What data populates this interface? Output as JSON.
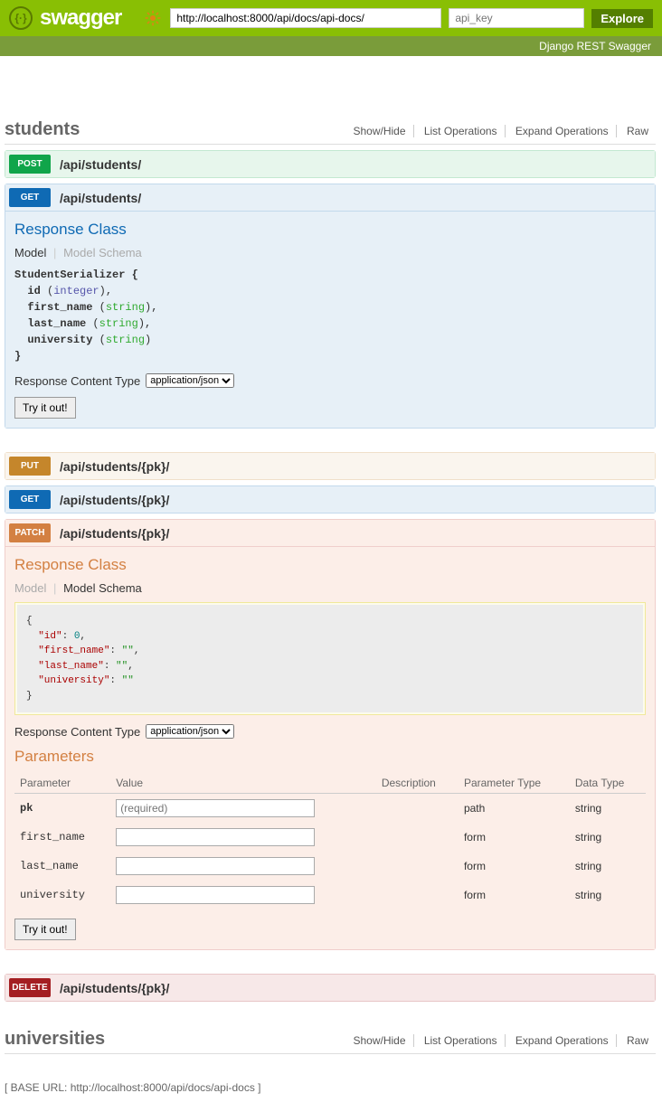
{
  "header": {
    "logo": "swagger",
    "url": "http://localhost:8000/api/docs/api-docs/",
    "apikey_placeholder": "api_key",
    "explore": "Explore",
    "subtitle": "Django REST Swagger"
  },
  "resources": {
    "students": {
      "title": "students",
      "actions": {
        "showhide": "Show/Hide",
        "list": "List Operations",
        "expand": "Expand Operations",
        "raw": "Raw"
      }
    },
    "universities": {
      "title": "universities",
      "actions": {
        "showhide": "Show/Hide",
        "list": "List Operations",
        "expand": "Expand Operations",
        "raw": "Raw"
      }
    }
  },
  "ops": {
    "post": {
      "method": "POST",
      "path": "/api/students/"
    },
    "get": {
      "method": "GET",
      "path": "/api/students/"
    },
    "put": {
      "method": "PUT",
      "path": "/api/students/{pk}/"
    },
    "get2": {
      "method": "GET",
      "path": "/api/students/{pk}/"
    },
    "patch": {
      "method": "PATCH",
      "path": "/api/students/{pk}/"
    },
    "del": {
      "method": "DELETE",
      "path": "/api/students/{pk}/"
    }
  },
  "labels": {
    "response_class": "Response Class",
    "model": "Model",
    "model_schema": "Model Schema",
    "resp_content_type": "Response Content Type",
    "content_type": "application/json",
    "try": "Try it out!",
    "parameters": "Parameters",
    "th_parameter": "Parameter",
    "th_value": "Value",
    "th_description": "Description",
    "th_param_type": "Parameter Type",
    "th_data_type": "Data Type"
  },
  "get_model": {
    "name": "StudentSerializer",
    "f1": "id",
    "t1": "integer",
    "f2": "first_name",
    "t2": "string",
    "f3": "last_name",
    "t3": "string",
    "f4": "university",
    "t4": "string"
  },
  "patch_schema": {
    "k1": "\"id\"",
    "v1": "0",
    "k2": "\"first_name\"",
    "v2": "\"\"",
    "k3": "\"last_name\"",
    "v3": "\"\"",
    "k4": "\"university\"",
    "v4": "\"\""
  },
  "patch_params": {
    "r1": {
      "name": "pk",
      "placeholder": "(required)",
      "ptype": "path",
      "dtype": "string"
    },
    "r2": {
      "name": "first_name",
      "ptype": "form",
      "dtype": "string"
    },
    "r3": {
      "name": "last_name",
      "ptype": "form",
      "dtype": "string"
    },
    "r4": {
      "name": "university",
      "ptype": "form",
      "dtype": "string"
    }
  },
  "footer": {
    "label": "[ BASE URL: ",
    "url": "http://localhost:8000/api/docs/api-docs",
    "close": " ]"
  }
}
